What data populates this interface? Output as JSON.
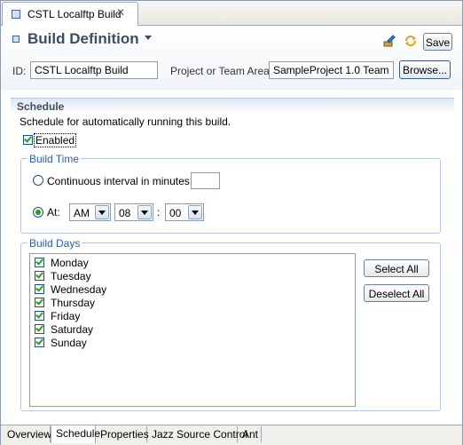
{
  "editor_tab": {
    "title": "CSTL Localftp Build",
    "close": "✕"
  },
  "header": {
    "title": "Build Definition",
    "save_label": "Save",
    "id_label": "ID:",
    "id_value": "CSTL Localftp Build",
    "team_label": "Project or Team Area:",
    "team_value": "SampleProject 1.0 Team",
    "browse_label": "Browse..."
  },
  "schedule": {
    "title": "Schedule",
    "description": "Schedule for automatically running this build.",
    "enabled_label": "Enabled",
    "enabled": true,
    "build_time": {
      "legend": "Build Time",
      "continuous_label": "Continuous interval in minutes:",
      "interval_value": "",
      "at_label": "At:",
      "selected_mode": "at",
      "ampm": "AM",
      "hour": "08",
      "colon": ":",
      "minute": "00"
    },
    "build_days": {
      "legend": "Build Days",
      "days": [
        {
          "label": "Monday",
          "checked": true
        },
        {
          "label": "Tuesday",
          "checked": true
        },
        {
          "label": "Wednesday",
          "checked": true
        },
        {
          "label": "Thursday",
          "checked": true
        },
        {
          "label": "Friday",
          "checked": true
        },
        {
          "label": "Saturday",
          "checked": true
        },
        {
          "label": "Sunday",
          "checked": true
        }
      ],
      "select_all_label": "Select All",
      "deselect_all_label": "Deselect All"
    }
  },
  "bottom_tabs": [
    {
      "label": "Overview"
    },
    {
      "label": "Schedule",
      "active": true
    },
    {
      "label": "Properties"
    },
    {
      "label": "Jazz Source Control"
    },
    {
      "label": "Ant"
    }
  ],
  "colors": {
    "accent": "#2b5ea8",
    "title": "#3f4c62",
    "check": "#21a121"
  }
}
